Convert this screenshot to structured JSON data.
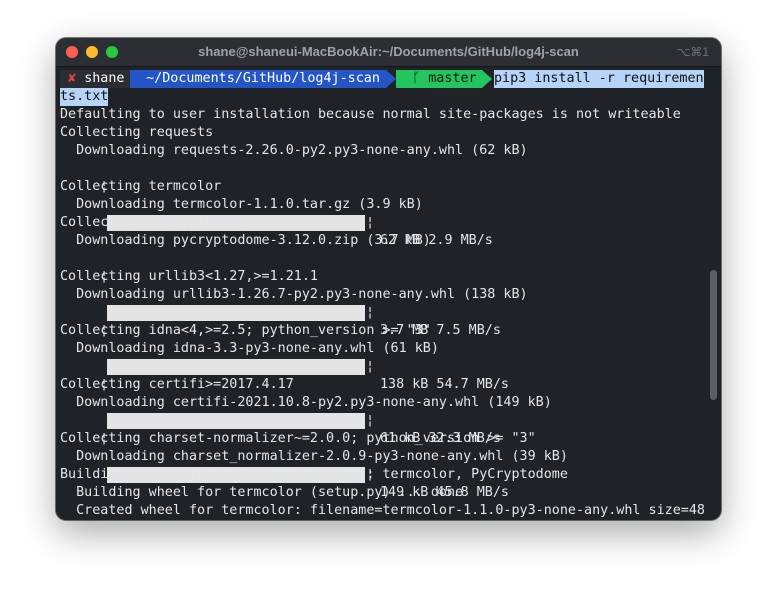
{
  "window": {
    "title": "shane@shaneui-MacBookAir:~/Documents/GitHub/log4j-scan",
    "shortcut": "⌥⌘1"
  },
  "prompt": {
    "status_symbol": "✘",
    "user": "shane",
    "path": "~/Documents/GitHub/log4j-scan",
    "git_branch": "ᚴ master",
    "command_part1": "pip3 install -r requiremen",
    "command_part2": "ts.txt"
  },
  "output": {
    "l1": "Defaulting to user installation because normal site-packages is not writeable",
    "l2": "Collecting requests",
    "l3": "  Downloading requests-2.26.0-py2.py3-none-any.whl (62 kB)",
    "l5": "Collecting termcolor",
    "l6": "  Downloading termcolor-1.1.0.tar.gz (3.9 kB)",
    "l7": "Collecting PyCryptodome",
    "l8": "  Downloading pycryptodome-3.12.0.zip (3.7 MB)",
    "l10": "Collecting urllib3<1.27,>=1.21.1",
    "l11": "  Downloading urllib3-1.26.7-py2.py3-none-any.whl (138 kB)",
    "l13": "Collecting idna<4,>=2.5; python_version >= \"3\"",
    "l14": "  Downloading idna-3.3-py3-none-any.whl (61 kB)",
    "l16": "Collecting certifi>=2017.4.17",
    "l17": "  Downloading certifi-2021.10.8-py2.py3-none-any.whl (149 kB)",
    "l19": "Collecting charset-normalizer~=2.0.0; python_version >= \"3\"",
    "l20": "  Downloading charset_normalizer-2.0.9-py3-none-any.whl (39 kB)",
    "l21": "Building wheels for collected packages: termcolor, PyCryptodome",
    "l22": "  Building wheel for termcolor (setup.py) ... done",
    "l23": "  Created wheel for termcolor: filename=termcolor-1.1.0-py3-none-any.whl size=48"
  },
  "progress": [
    {
      "stats": "62 kB 2.9 MB/s",
      "fraction": 1.0
    },
    {
      "stats": "3.7 MB 7.5 MB/s",
      "fraction": 1.0
    },
    {
      "stats": "138 kB 54.7 MB/s",
      "fraction": 1.0
    },
    {
      "stats": "61 kB 32.3 MB/s",
      "fraction": 1.0
    },
    {
      "stats": "149 kB 45.8 MB/s",
      "fraction": 1.0
    }
  ],
  "bar_edge": "¦",
  "colors": {
    "background": "#1f2227",
    "text": "#e4e6e8",
    "path_segment": "#2455c7",
    "git_segment": "#22c55e",
    "selection": "#b6d3f8",
    "error_mark": "#e8473e"
  },
  "icons": {
    "close": "close-traffic-light-icon",
    "minimize": "minimize-traffic-light-icon",
    "zoom": "zoom-traffic-light-icon",
    "git": "git-branch-icon"
  }
}
